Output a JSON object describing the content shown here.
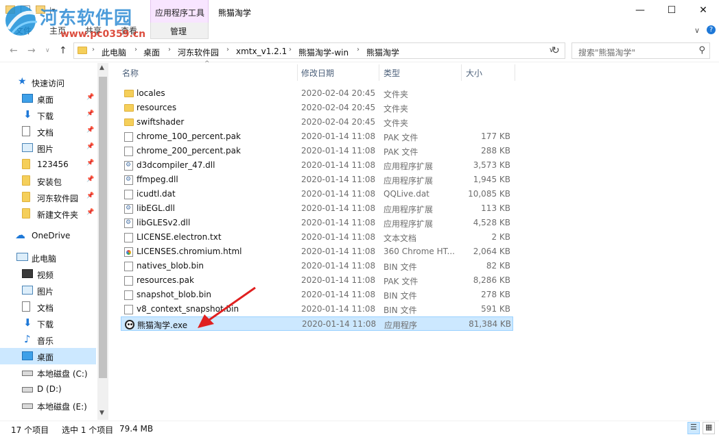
{
  "ribbon": {
    "context_tab_header": "应用程序工具",
    "context_tab": "管理",
    "window_title": "熊猫淘学",
    "tabs": [
      "文件",
      "主页",
      "共享",
      "查看"
    ]
  },
  "watermark": {
    "text": "河东软件园",
    "url": "www.pc0359.cn"
  },
  "window_controls": {
    "minimize": "—",
    "maximize": "☐",
    "close": "✕"
  },
  "address_bar": {
    "crumbs": [
      "此电脑",
      "桌面",
      "河东软件园",
      "xmtx_v1.2.1",
      "熊猫淘学-win",
      "熊猫淘学"
    ],
    "refresh_icon": "refresh-icon"
  },
  "search": {
    "placeholder": "搜索\"熊猫淘学\""
  },
  "nav_pane": {
    "quick_access": "快速访问",
    "quick_items": [
      "桌面",
      "下载",
      "文档",
      "图片",
      "123456",
      "安装包",
      "河东软件园",
      "新建文件夹"
    ],
    "onedrive": "OneDrive",
    "this_pc": "此电脑",
    "pc_items": [
      "视频",
      "图片",
      "文档",
      "下载",
      "音乐",
      "桌面",
      "本地磁盘 (C:)",
      "D (D:)",
      "本地磁盘 (E:)"
    ],
    "selected": "桌面"
  },
  "columns": {
    "name": "名称",
    "date": "修改日期",
    "type": "类型",
    "size": "大小"
  },
  "files": [
    {
      "name": "locales",
      "date": "2020-02-04 20:45",
      "type": "文件夹",
      "size": "",
      "icon": "folder"
    },
    {
      "name": "resources",
      "date": "2020-02-04 20:45",
      "type": "文件夹",
      "size": "",
      "icon": "folder"
    },
    {
      "name": "swiftshader",
      "date": "2020-02-04 20:45",
      "type": "文件夹",
      "size": "",
      "icon": "folder"
    },
    {
      "name": "chrome_100_percent.pak",
      "date": "2020-01-14 11:08",
      "type": "PAK 文件",
      "size": "177 KB",
      "icon": "file"
    },
    {
      "name": "chrome_200_percent.pak",
      "date": "2020-01-14 11:08",
      "type": "PAK 文件",
      "size": "288 KB",
      "icon": "file"
    },
    {
      "name": "d3dcompiler_47.dll",
      "date": "2020-01-14 11:08",
      "type": "应用程序扩展",
      "size": "3,573 KB",
      "icon": "dll"
    },
    {
      "name": "ffmpeg.dll",
      "date": "2020-01-14 11:08",
      "type": "应用程序扩展",
      "size": "1,945 KB",
      "icon": "dll"
    },
    {
      "name": "icudtl.dat",
      "date": "2020-01-14 11:08",
      "type": "QQLive.dat",
      "size": "10,085 KB",
      "icon": "file"
    },
    {
      "name": "libEGL.dll",
      "date": "2020-01-14 11:08",
      "type": "应用程序扩展",
      "size": "113 KB",
      "icon": "dll"
    },
    {
      "name": "libGLESv2.dll",
      "date": "2020-01-14 11:08",
      "type": "应用程序扩展",
      "size": "4,528 KB",
      "icon": "dll"
    },
    {
      "name": "LICENSE.electron.txt",
      "date": "2020-01-14 11:08",
      "type": "文本文档",
      "size": "2 KB",
      "icon": "file"
    },
    {
      "name": "LICENSES.chromium.html",
      "date": "2020-01-14 11:08",
      "type": "360 Chrome HT...",
      "size": "2,064 KB",
      "icon": "html"
    },
    {
      "name": "natives_blob.bin",
      "date": "2020-01-14 11:08",
      "type": "BIN 文件",
      "size": "82 KB",
      "icon": "file"
    },
    {
      "name": "resources.pak",
      "date": "2020-01-14 11:08",
      "type": "PAK 文件",
      "size": "8,286 KB",
      "icon": "file"
    },
    {
      "name": "snapshot_blob.bin",
      "date": "2020-01-14 11:08",
      "type": "BIN 文件",
      "size": "278 KB",
      "icon": "file"
    },
    {
      "name": "v8_context_snapshot.bin",
      "date": "2020-01-14 11:08",
      "type": "BIN 文件",
      "size": "591 KB",
      "icon": "file"
    },
    {
      "name": "熊猫淘学.exe",
      "date": "2020-01-14 11:08",
      "type": "应用程序",
      "size": "81,384 KB",
      "icon": "exe"
    }
  ],
  "selected_file": "熊猫淘学.exe",
  "status": {
    "count": "17 个项目",
    "selection": "选中 1 个项目",
    "size": "79.4 MB"
  },
  "colors": {
    "selection": "#cce8ff",
    "context_tab": "#f8e5ff",
    "arrow": "#e02020"
  }
}
